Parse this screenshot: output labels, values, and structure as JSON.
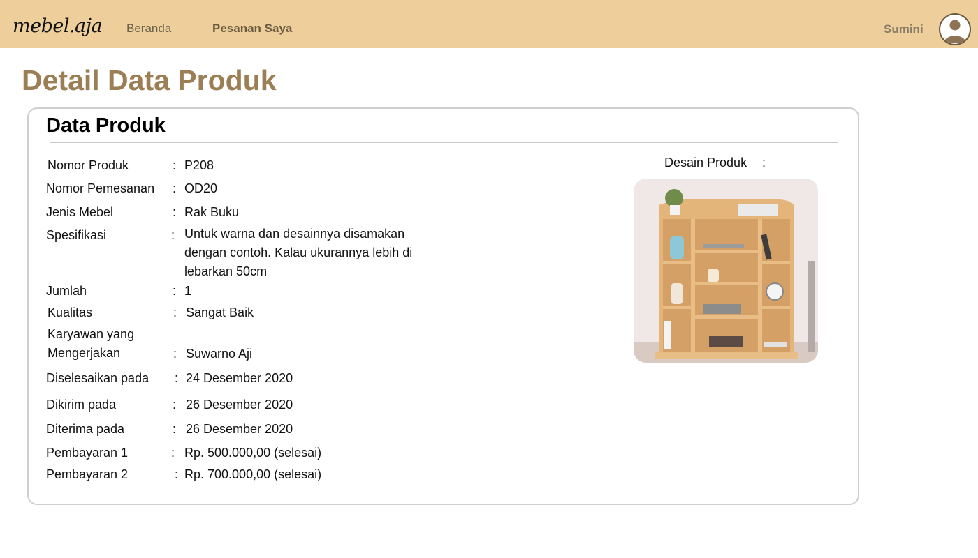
{
  "nav": {
    "logo": "mebel.aja",
    "links": [
      "Beranda",
      "Pesanan Saya"
    ],
    "active_link": "Pesanan Saya",
    "username": "Sumini"
  },
  "page": {
    "title": "Detail Data Produk"
  },
  "card": {
    "title": "Data Produk",
    "colon": ":",
    "fields": [
      {
        "label": "Nomor Produk",
        "value": "P208"
      },
      {
        "label": "Nomor Pemesanan",
        "value": "OD20"
      },
      {
        "label": "Jenis Mebel",
        "value": "Rak Buku"
      },
      {
        "label": "Spesifikasi",
        "value": "Untuk warna dan desainnya disamakan dengan contoh. Kalau ukurannya lebih di lebarkan 50cm"
      },
      {
        "label": "Jumlah",
        "value": "1"
      },
      {
        "label": "Kualitas",
        "value": "Sangat Baik"
      },
      {
        "label": "Karyawan yang Mengerjakan",
        "value": "Suwarno Aji"
      },
      {
        "label": "Diselesaikan pada",
        "value": "24 Desember 2020"
      },
      {
        "label": "Dikirim pada",
        "value": "26 Desember 2020"
      },
      {
        "label": "Diterima pada",
        "value": "26 Desember 2020"
      },
      {
        "label": "Pembayaran 1",
        "value": "Rp. 500.000,00 (selesai)"
      },
      {
        "label": "Pembayaran 2",
        "value": "Rp. 700.000,00 (selesai)"
      }
    ],
    "design_label": "Desain Produk"
  },
  "icons": {
    "avatar": "user-avatar-icon",
    "product_image": "bookshelf-photo"
  },
  "colors": {
    "navbar": "#eecf9c",
    "title": "#9c7e55",
    "wood": "#e3b57a"
  }
}
